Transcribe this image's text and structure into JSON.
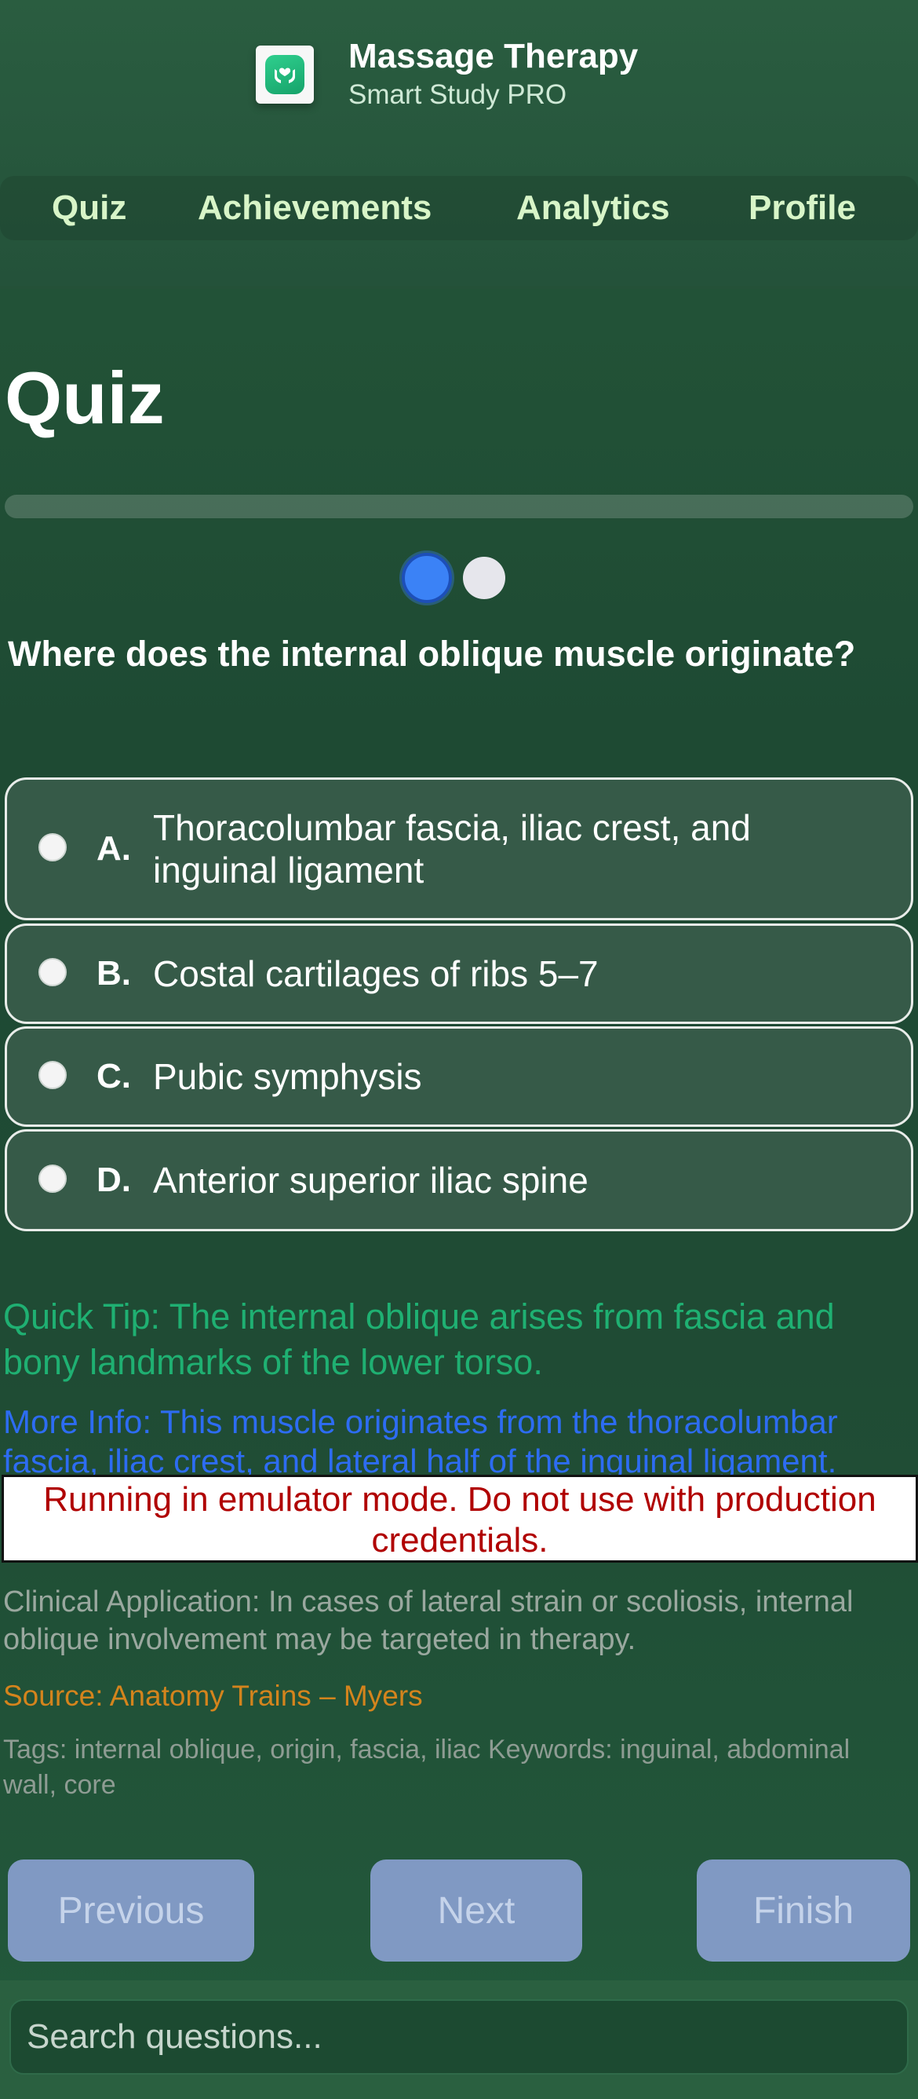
{
  "header": {
    "app_title": "Massage Therapy",
    "app_subtitle": "Smart Study PRO",
    "icon": "hands-heart-icon",
    "nav": [
      "Quiz",
      "Achievements",
      "Analytics",
      "Profile"
    ]
  },
  "main": {
    "title": "Quiz",
    "progress": 0,
    "question": "Where does the internal oblique muscle originate?",
    "options": [
      {
        "letter": "A.",
        "text": "Thoracolumbar fascia, iliac crest, and inguinal ligament"
      },
      {
        "letter": "B.",
        "text": "Costal cartilages of ribs 5–7"
      },
      {
        "letter": "C.",
        "text": "Pubic symphysis"
      },
      {
        "letter": "D.",
        "text": "Anterior superior iliac spine"
      }
    ],
    "quick_tip": "Quick Tip: The internal oblique arises from fascia and bony landmarks of the lower torso.",
    "more_info": "More Info: This muscle originates from the thoracolumbar fascia, iliac crest, and lateral half of the inguinal ligament.",
    "emulator_banner": "Running in emulator mode. Do not use with production credentials.",
    "clinical": "Clinical Application: In cases of lateral strain or scoliosis, internal oblique involvement may be targeted in therapy.",
    "source": "Source: Anatomy Trains – Myers",
    "tags": "Tags: internal oblique, origin, fascia, iliac Keywords: inguinal, abdominal wall, core"
  },
  "buttons": {
    "previous": "Previous",
    "next": "Next",
    "finish": "Finish"
  },
  "search": {
    "placeholder": "Search questions..."
  },
  "colors": {
    "accent": "#3b82f6",
    "tip": "#1fb072",
    "info": "#2d6cf2",
    "source": "#d4841d",
    "warning": "#b00000"
  }
}
